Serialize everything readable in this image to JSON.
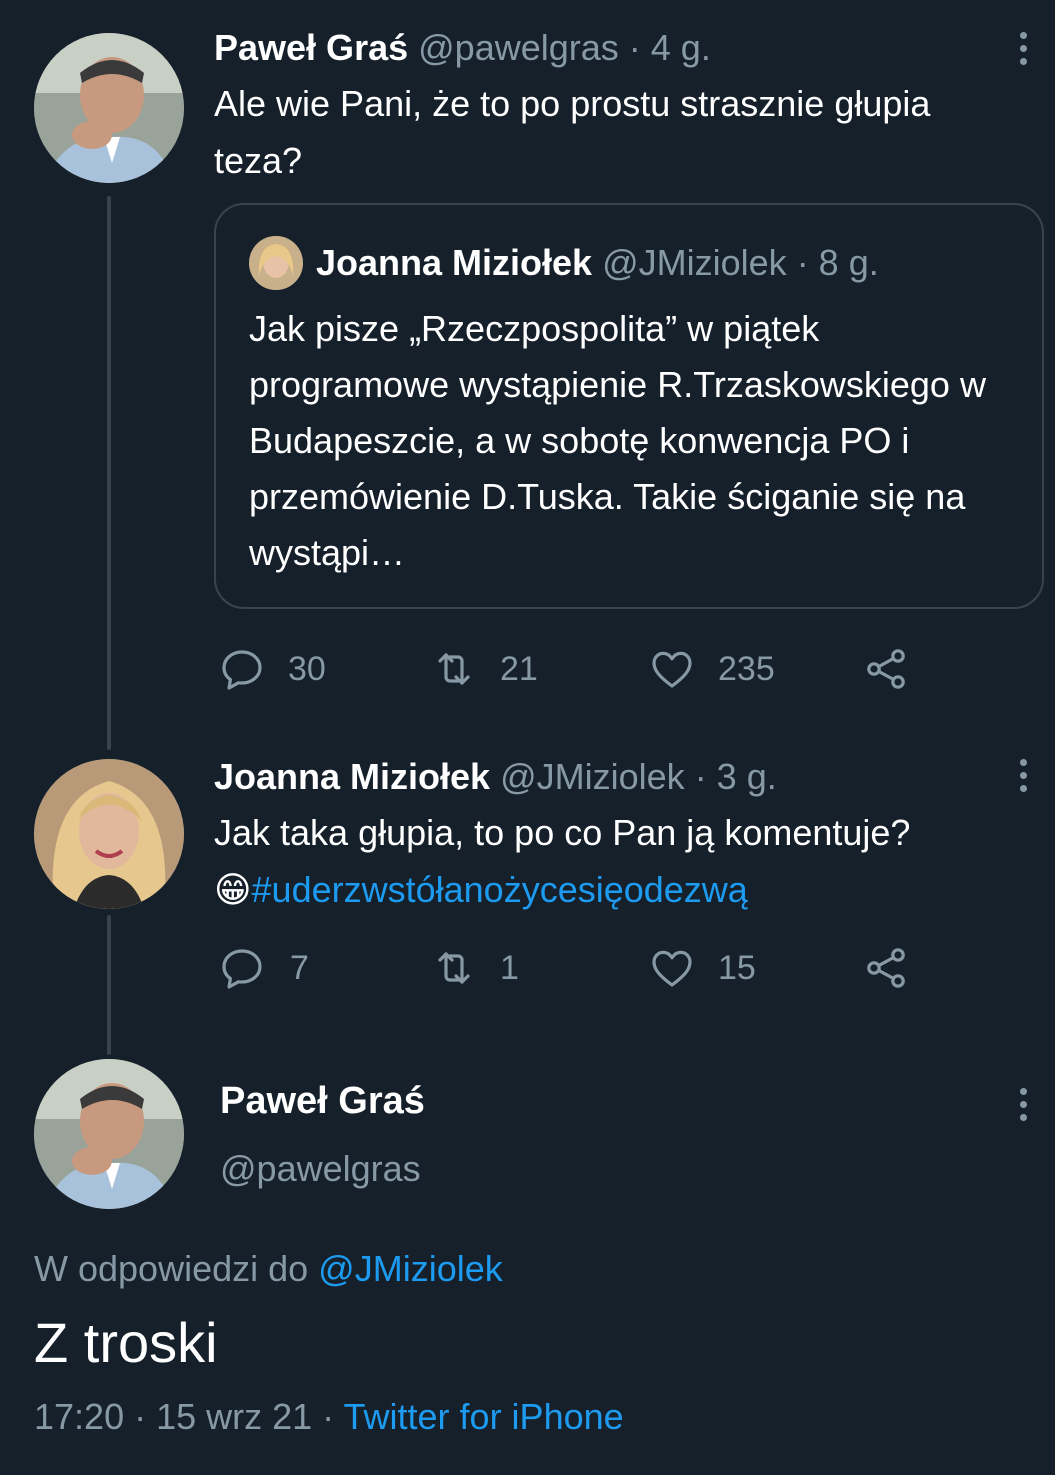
{
  "tweet1": {
    "name": "Paweł Graś",
    "handle": "@pawelgras",
    "time": "· 4 g.",
    "text": "Ale wie Pani, że to po prostu strasznie głupia teza?",
    "quote": {
      "name": "Joanna Miziołek",
      "handle": "@JMiziolek",
      "time": "· 8 g.",
      "text": "Jak pisze „Rzeczpospolita” w piątek programowe wystąpienie R.Trzaskowskiego w Budapeszcie, a w sobotę konwencja PO i przemówienie D.Tuska. Takie ściganie się na wystąpi…"
    },
    "actions": {
      "replies": "30",
      "retweets": "21",
      "likes": "235"
    }
  },
  "tweet2": {
    "name": "Joanna Miziołek",
    "handle": "@JMiziolek",
    "time": "· 3 g.",
    "text": "Jak taka głupia, to po co Pan ją komentuje?",
    "emoji": "😁",
    "hashtag": "#uderzwstółanożycesięodezwą",
    "actions": {
      "replies": "7",
      "retweets": "1",
      "likes": "15"
    }
  },
  "main_tweet": {
    "name": "Paweł Graś",
    "handle": "@pawelgras",
    "reply_prefix": "W odpowiedzi do",
    "reply_to": "@JMiziolek",
    "text": "Z troski",
    "time": "17:20",
    "date": "· 15 wrz 21 ·",
    "source": "Twitter for iPhone"
  },
  "colors": {
    "background": "#15202b",
    "muted": "#8899a6",
    "link": "#1d9bf0",
    "border": "#38444d"
  },
  "icons": [
    "more-vertical-icon",
    "reply-icon",
    "retweet-icon",
    "like-icon",
    "share-icon"
  ]
}
